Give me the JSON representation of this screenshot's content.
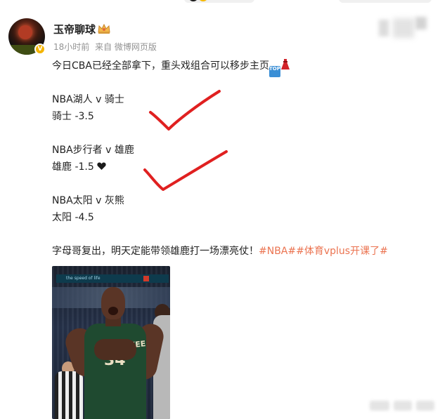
{
  "post": {
    "username": "玉帝聊球",
    "verified_badge": "V",
    "crown_icon": "crown-icon",
    "time": "18小时前",
    "source": "来自 微博网页版",
    "lines": {
      "intro": "今日CBA已经全部拿下，重头戏组合可以移步主页",
      "game1_title": "NBA湖人 v 骑士",
      "game1_pick": "骑士 -3.5",
      "game2_title": "NBA步行者 v 雄鹿",
      "game2_pick": "雄鹿 -1.5",
      "game3_title": "NBA太阳 v 灰熊",
      "game3_pick": "太阳 -4.5",
      "closing": "字母哥复出，明天定能带领雄鹿打一场漂亮仗！",
      "hashtags": "#NBA##体育vplus开课了#"
    },
    "emojis": {
      "top_label": "TOP",
      "heart": "🖤"
    },
    "image": {
      "jersey_text": "MILWAUKEE",
      "jersey_number": "34",
      "board_text": "the speed of life"
    },
    "colors": {
      "hashtag": "#eb7350",
      "checkmark": "#e02020",
      "verified": "#f4b400"
    }
  }
}
